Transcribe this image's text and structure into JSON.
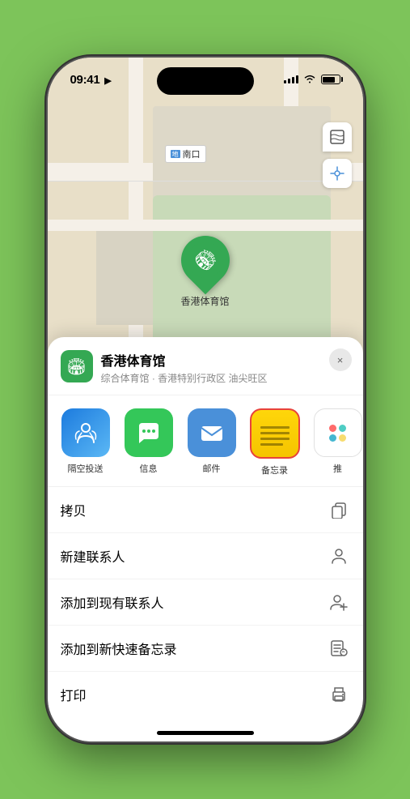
{
  "phone": {
    "status_bar": {
      "time": "09:41",
      "signal_bars": [
        4,
        6,
        8,
        10,
        12
      ],
      "navigation_arrow": "▶"
    },
    "map": {
      "label_text": "南口",
      "location_name": "香港体育馆",
      "controls": {
        "map_icon": "🗺",
        "location_icon": "⊕"
      }
    },
    "bottom_sheet": {
      "venue_name": "香港体育馆",
      "venue_subtitle": "综合体育馆 · 香港特别行政区 油尖旺区",
      "close_label": "×",
      "share_items": [
        {
          "id": "airdrop",
          "label": "隔空投送",
          "icon": "airdrop"
        },
        {
          "id": "messages",
          "label": "信息",
          "icon": "messages"
        },
        {
          "id": "mail",
          "label": "邮件",
          "icon": "mail"
        },
        {
          "id": "notes",
          "label": "备忘录",
          "icon": "notes",
          "selected": true
        },
        {
          "id": "more",
          "label": "推",
          "icon": "more"
        }
      ],
      "actions": [
        {
          "id": "copy",
          "label": "拷贝",
          "icon": "copy"
        },
        {
          "id": "new-contact",
          "label": "新建联系人",
          "icon": "person"
        },
        {
          "id": "add-contact",
          "label": "添加到现有联系人",
          "icon": "person-add"
        },
        {
          "id": "quick-note",
          "label": "添加到新快速备忘录",
          "icon": "note"
        },
        {
          "id": "print",
          "label": "打印",
          "icon": "print"
        }
      ]
    }
  }
}
